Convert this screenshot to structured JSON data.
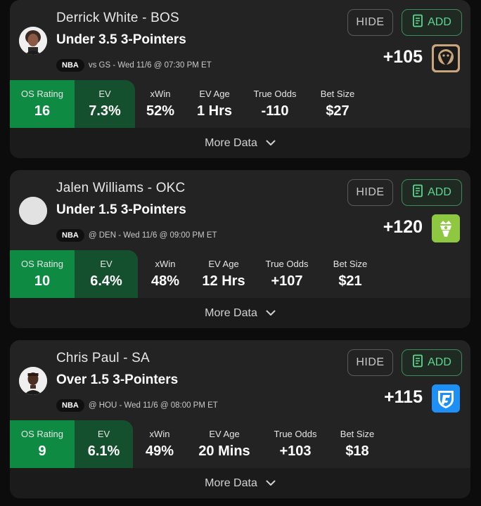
{
  "cards": [
    {
      "player": "Derrick White - BOS",
      "market": "Under 3.5 3-Pointers",
      "league": "NBA",
      "game": "vs GS - Wed 11/6 @ 07:30 PM ET",
      "odds": "+105",
      "book_icon": "lion-sportsbook-icon",
      "hide_label": "HIDE",
      "add_label": "ADD",
      "stats": {
        "os_rating_label": "OS Rating",
        "os_rating": "16",
        "ev_label": "EV",
        "ev": "7.3%",
        "xwin_label": "xWin",
        "xwin": "52%",
        "ev_age_label": "EV Age",
        "ev_age": "1 Hrs",
        "true_odds_label": "True Odds",
        "true_odds": "-110",
        "bet_size_label": "Bet Size",
        "bet_size": "$27"
      },
      "more_label": "More Data"
    },
    {
      "player": "Jalen Williams - OKC",
      "market": "Under 1.5 3-Pointers",
      "league": "NBA",
      "game": "@ DEN - Wed 11/6 @ 09:00 PM ET",
      "odds": "+120",
      "book_icon": "draftkings-icon",
      "hide_label": "HIDE",
      "add_label": "ADD",
      "stats": {
        "os_rating_label": "OS Rating",
        "os_rating": "10",
        "ev_label": "EV",
        "ev": "6.4%",
        "xwin_label": "xWin",
        "xwin": "48%",
        "ev_age_label": "EV Age",
        "ev_age": "12 Hrs",
        "true_odds_label": "True Odds",
        "true_odds": "+107",
        "bet_size_label": "Bet Size",
        "bet_size": "$21"
      },
      "more_label": "More Data"
    },
    {
      "player": "Chris Paul - SA",
      "market": "Over 1.5 3-Pointers",
      "league": "NBA",
      "game": "@ HOU - Wed 11/6 @ 08:00 PM ET",
      "odds": "+115",
      "book_icon": "fanduel-icon",
      "hide_label": "HIDE",
      "add_label": "ADD",
      "stats": {
        "os_rating_label": "OS Rating",
        "os_rating": "9",
        "ev_label": "EV",
        "ev": "6.1%",
        "xwin_label": "xWin",
        "xwin": "49%",
        "ev_age_label": "EV Age",
        "ev_age": "20 Mins",
        "true_odds_label": "True Odds",
        "true_odds": "+103",
        "bet_size_label": "Bet Size",
        "bet_size": "$18"
      },
      "more_label": "More Data"
    }
  ],
  "colors": {
    "os_rating_bg": "#0f8a43",
    "ev_bg": "#14502d",
    "add_accent": "#5ed68e",
    "card_bg": "#232323"
  }
}
